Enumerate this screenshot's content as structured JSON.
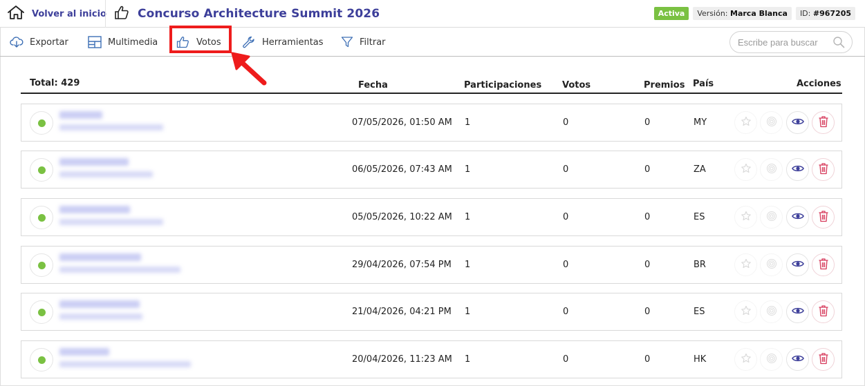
{
  "header": {
    "home_label": "Volver al inicio",
    "title": "Concurso Architecture Summit 2026",
    "status_badge": "Activa",
    "version_prefix": "Versión:",
    "version_value": "Marca Blanca",
    "id_prefix": "ID:",
    "id_value": "#967205"
  },
  "toolbar": {
    "items": [
      {
        "label": "Exportar",
        "icon": "cloud-download-icon"
      },
      {
        "label": "Multimedia",
        "icon": "layout-grid-icon"
      },
      {
        "label": "Votos",
        "icon": "thumbs-up-icon"
      },
      {
        "label": "Herramientas",
        "icon": "wrench-icon"
      },
      {
        "label": "Filtrar",
        "icon": "filter-icon"
      }
    ],
    "search_placeholder": "Escribe para buscar"
  },
  "table": {
    "total_label": "Total: 429",
    "columns": [
      "Fecha",
      "Participaciones",
      "Votos",
      "Premios",
      "País",
      "Acciones"
    ],
    "rows": [
      {
        "date": "07/05/2026, 01:50 AM",
        "participations": "1",
        "votes": "0",
        "prizes": "0",
        "country": "MY",
        "status": "active"
      },
      {
        "date": "06/05/2026, 07:43 AM",
        "participations": "1",
        "votes": "0",
        "prizes": "0",
        "country": "ZA",
        "status": "active"
      },
      {
        "date": "05/05/2026, 10:22 AM",
        "participations": "1",
        "votes": "0",
        "prizes": "0",
        "country": "ES",
        "status": "active"
      },
      {
        "date": "29/04/2026, 07:54 PM",
        "participations": "1",
        "votes": "0",
        "prizes": "0",
        "country": "BR",
        "status": "active"
      },
      {
        "date": "21/04/2026, 04:21 PM",
        "participations": "1",
        "votes": "0",
        "prizes": "0",
        "country": "ES",
        "status": "active"
      },
      {
        "date": "20/04/2026, 11:23 AM",
        "participations": "1",
        "votes": "0",
        "prizes": "0",
        "country": "HK",
        "status": "active"
      }
    ]
  },
  "colors": {
    "brand": "#3d3f9a",
    "active_green": "#7ac142",
    "highlight_red": "#ee1c1c",
    "delete_pink": "#d6395a"
  }
}
